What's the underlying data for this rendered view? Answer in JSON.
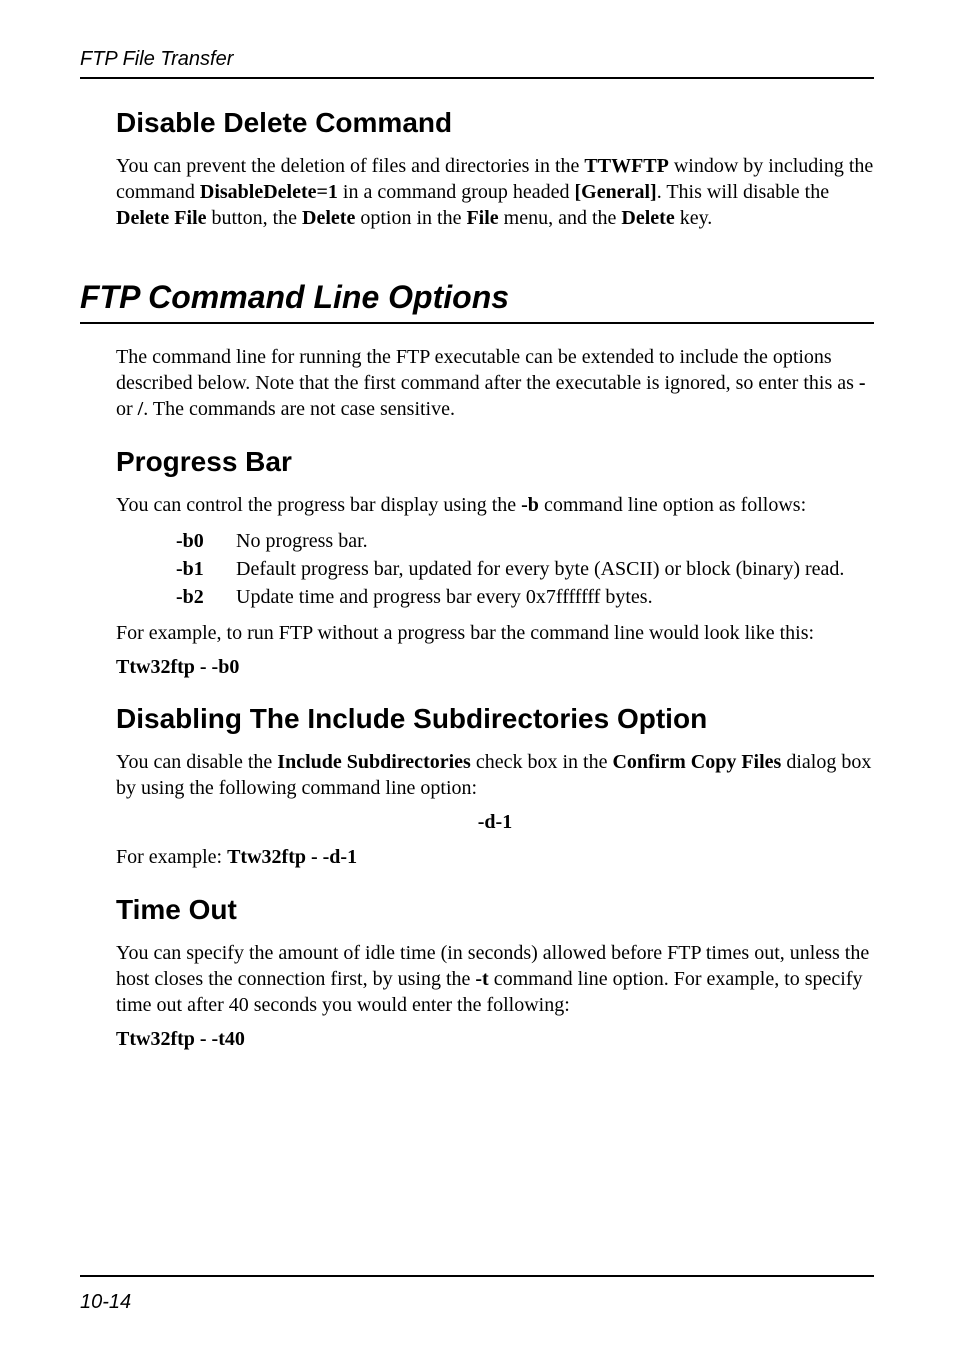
{
  "running_head": "FTP File Transfer",
  "page_number": "10-14",
  "sec_disable_delete": {
    "heading": "Disable Delete Command",
    "para_parts": [
      "You can prevent the deletion of files and directories in the ",
      "TTWFTP",
      " window by including the command ",
      "DisableDelete=1",
      " in a command group headed ",
      "[General]",
      ". This will disable the ",
      "Delete File",
      " button, the ",
      "Delete",
      " option in the ",
      "File",
      " menu, and the ",
      "Delete",
      " key."
    ]
  },
  "chapter_heading": "FTP Command Line Options",
  "chapter_intro_parts": [
    "The command line for running the FTP executable can be extended to include the options described below. Note that the first command after the executable is ignored, so enter this as ",
    "-",
    " or ",
    "/",
    ". The commands are not case sensitive."
  ],
  "sec_progress": {
    "heading": "Progress Bar",
    "intro_parts": [
      "You can control the progress bar display using the ",
      "-b",
      " command line option as follows:"
    ],
    "options": [
      {
        "key": "-b0",
        "desc": "No progress bar."
      },
      {
        "key": "-b1",
        "desc": "Default progress bar, updated for every byte (ASCII) or block (binary) read."
      },
      {
        "key": "-b2",
        "desc": "Update time and progress bar every 0x7fffffff bytes."
      }
    ],
    "outro": "For example, to run FTP without a progress bar the command line would look like this:",
    "example": "Ttw32ftp  -  -b0"
  },
  "sec_subdirs": {
    "heading": "Disabling The Include Subdirectories Option",
    "intro_parts": [
      "You can disable the ",
      "Include Subdirectories",
      " check box in the ",
      "Confirm Copy Files",
      " dialog box by using the following command line option:"
    ],
    "option_flag": "-d-1",
    "example_prefix": "For example:   ",
    "example_cmd": "Ttw32ftp  -  -d-1"
  },
  "sec_timeout": {
    "heading": "Time Out",
    "intro_parts": [
      "You can specify the amount of idle time (in seconds) allowed before FTP times out, unless the host closes the connection first, by using the ",
      "-t",
      " command line option. For example, to specify time out after 40 seconds you would enter the following:"
    ],
    "example": "Ttw32ftp  -  -t40"
  }
}
